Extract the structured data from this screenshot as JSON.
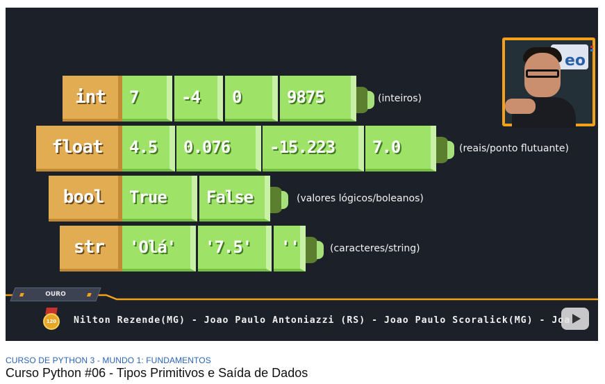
{
  "video": {
    "rows": [
      {
        "type": "int",
        "values": [
          "7",
          "-4",
          "0",
          "9875"
        ],
        "desc": "(inteiros)"
      },
      {
        "type": "float",
        "values": [
          "4.5",
          "0.076",
          "-15.223",
          "7.0"
        ],
        "desc": "(reais/ponto flutuante)"
      },
      {
        "type": "bool",
        "values": [
          "True",
          "False"
        ],
        "desc": "(valores lógicos/boleanos)"
      },
      {
        "type": "str",
        "values": [
          "'Olá'",
          "'7.5'",
          "''"
        ],
        "desc": "(caracteres/string)"
      }
    ],
    "webcam_sign": "eo",
    "badge_label": "OURO",
    "medal_text": "120",
    "ticker_text": "Nilton Rezende(MG) - Joao Paulo Antoniazzi (RS) - Joao Paulo Scoralick(MG) - Joa"
  },
  "playlist_label": "CURSO DE PYTHON 3 - MUNDO 1: FUNDAMENTOS",
  "video_title": "Curso Python #06 - Tipos Primitivos e Saída de Dados",
  "colors": {
    "type_block": "#e2ac52",
    "value_block": "#9fe268",
    "accent": "#f2a21a",
    "background": "#1c2029",
    "playlist_link": "#2963b8"
  }
}
